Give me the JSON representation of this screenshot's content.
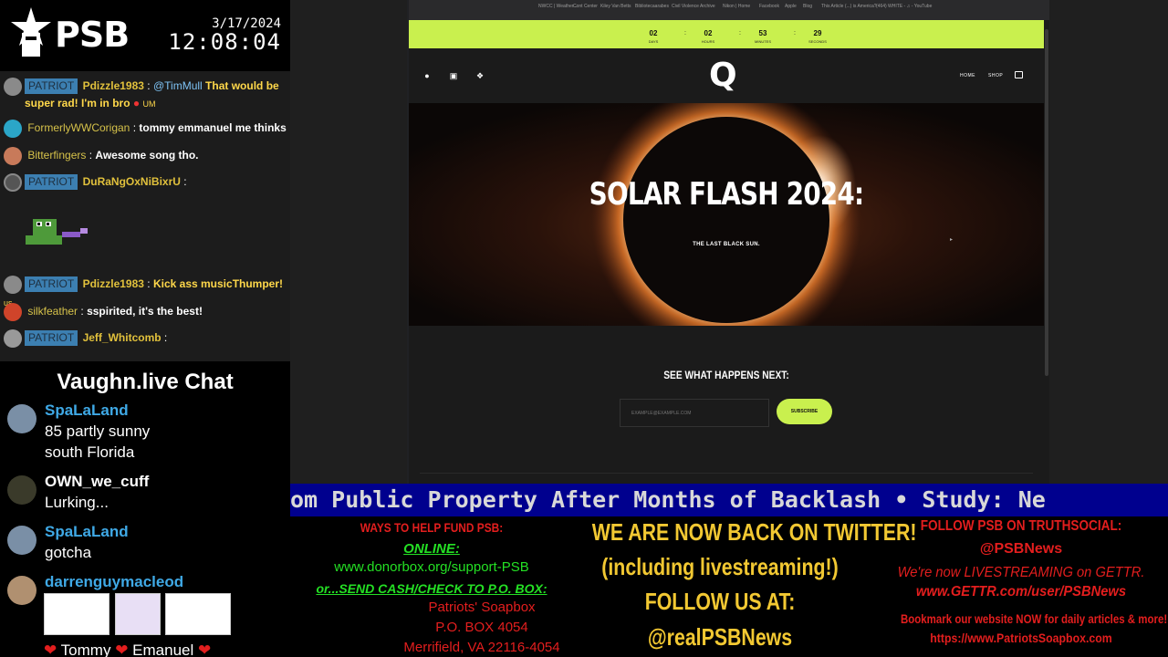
{
  "brand": {
    "logo_text": "PSB",
    "date": "3/17/2024",
    "time": "12:08:04"
  },
  "chat_top": {
    "messages": [
      {
        "badge": "PATRIOT",
        "user": "Pdizzle1983",
        "mention": "@TimMull",
        "text": "That would be",
        "text_line2": "super rad! I'm in bro",
        "emote": "UM"
      },
      {
        "user": "FormerlyWWCorigan",
        "text": "tommy emmanuel me thinks"
      },
      {
        "user": "Bitterfingers",
        "text": "Awesome song tho."
      },
      {
        "badge": "PATRIOT",
        "user": "DuRaNgOxNiBixrU",
        "text": ""
      },
      {
        "badge": "PATRIOT",
        "user": "Pdizzle1983",
        "text": "Kick ass musicThumper!",
        "emote": "us"
      },
      {
        "user": "silkfeather",
        "text": "sspirited, it's the best!"
      },
      {
        "badge": "PATRIOT",
        "user": "Jeff_Whitcomb",
        "text": ""
      }
    ]
  },
  "vaughn": {
    "title": "Vaughn.live Chat",
    "messages": [
      {
        "user": "SpaLaLand",
        "text": "85 partly sunny",
        "text2": "south Florida"
      },
      {
        "user": "OWN_we_cuff",
        "text": "Lurking..."
      },
      {
        "user": "SpaLaLand",
        "text": "gotcha"
      },
      {
        "user": "darrenguymacleod",
        "text": "Tommy",
        "text2": "Emanuel"
      }
    ]
  },
  "browser": {
    "tabs": [
      "NWCC | Weather...",
      "Cont Center",
      "Kiley Van Betts",
      "Bibliotecaarabes",
      "Civil Violence Archive",
      "Nikon | Home",
      "Facebook",
      "Apple",
      "Blog",
      "This Article (...) is America?",
      "(464) WHITE - ♫ - YouTube"
    ],
    "countdown": [
      {
        "value": "02",
        "label": "DAYS"
      },
      {
        "value": "02",
        "label": "HOURS"
      },
      {
        "value": "53",
        "label": "MINUTES"
      },
      {
        "value": "29",
        "label": "SECONDS"
      }
    ],
    "nav": {
      "logo": "Q",
      "home": "HOME",
      "shop": "SHOP"
    },
    "hero": {
      "title": "SOLAR FLASH 2024:",
      "subtitle": "THE LAST BLACK SUN."
    },
    "signup": {
      "title": "SEE WHAT HAPPENS NEXT:",
      "placeholder": "EXAMPLE@EXAMPLE.COM",
      "button": "SUBSCRIBE"
    },
    "accent_color": "#c9f04e"
  },
  "ticker": {
    "text": "om Public Property After Months of Backlash  •  Study: Ne"
  },
  "info": {
    "col1": {
      "heading": "WAYS TO HELP FUND PSB:",
      "online": "ONLINE:",
      "online_url": "www.donorbox.org/support-PSB",
      "mail": "or...SEND CASH/CHECK TO P.O. BOX:",
      "addr1": "Patriots' Soapbox",
      "addr2": "P.O. BOX 4054",
      "addr3": "Merrifield, VA 22116-4054"
    },
    "col2": {
      "line1": "WE ARE NOW BACK ON TWITTER!",
      "line2": "(including livestreaming!)",
      "line3": "FOLLOW US AT:",
      "line4": "@realPSBNews"
    },
    "col3": {
      "line1": "FOLLOW PSB ON TRUTHSOCIAL:",
      "line2": "@PSBNews",
      "line3": "We're now LIVESTREAMING on GETTR.",
      "line4": "www.GETTR.com/user/PSBNews",
      "line5": "Bookmark our website NOW for daily articles & more!",
      "line6": "https://www.PatriotsSoapbox.com"
    }
  }
}
